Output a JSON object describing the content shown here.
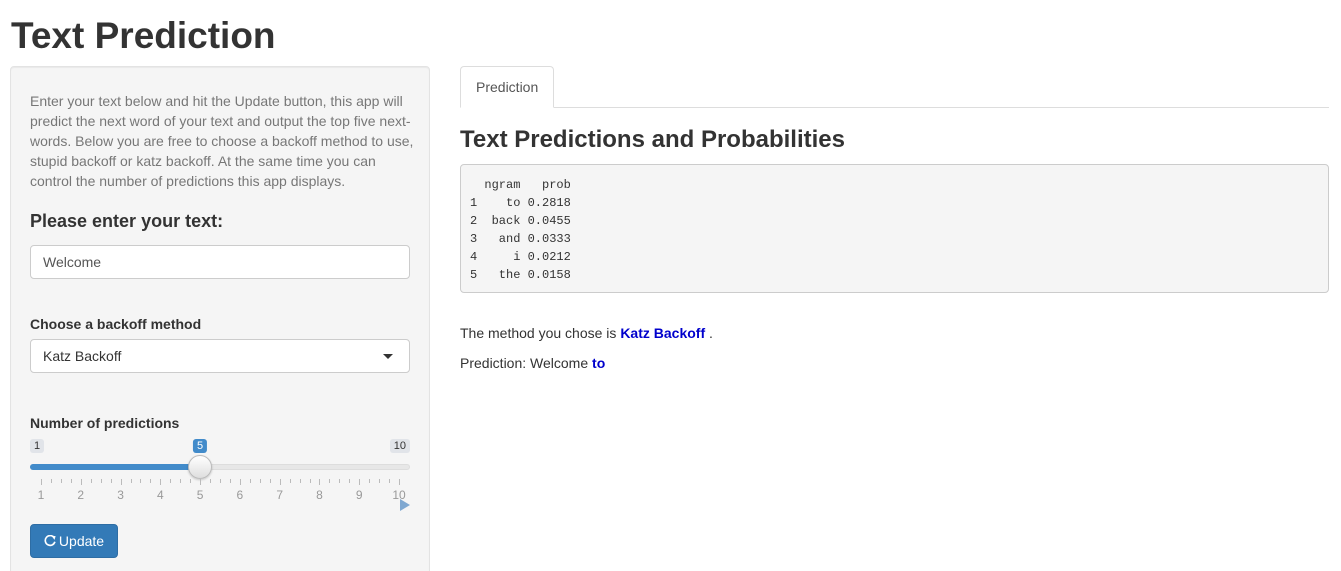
{
  "app": {
    "title": "Text Prediction"
  },
  "sidebar": {
    "intro": "Enter your text below and hit the Update button, this app will predict the next word of your text and output the top five next-words. Below you are free to choose a backoff method to use, stupid backoff or katz backoff. At the same time you can control the number of predictions this app displays.",
    "text_label": "Please enter your text:",
    "text_value": "Welcome",
    "method_label": "Choose a backoff method",
    "method_selected": "Katz Backoff",
    "slider": {
      "label": "Number of predictions",
      "min": 1,
      "max": 10,
      "value": 5,
      "min_label": "1",
      "max_label": "10",
      "value_label": "5",
      "tick_labels": [
        "1",
        "2",
        "3",
        "4",
        "5",
        "6",
        "7",
        "8",
        "9",
        "10"
      ]
    },
    "update_label": "Update",
    "colors": {
      "accent": "#337ab7",
      "slider_fill": "#428bca"
    }
  },
  "main": {
    "tabs": [
      {
        "label": "Prediction",
        "active": true
      }
    ],
    "result_title": "Text Predictions and Probabilities",
    "table": {
      "headers": [
        "ngram",
        "prob"
      ],
      "rows": [
        {
          "index": "1",
          "ngram": "to",
          "prob": "0.2818"
        },
        {
          "index": "2",
          "ngram": "back",
          "prob": "0.0455"
        },
        {
          "index": "3",
          "ngram": "and",
          "prob": "0.0333"
        },
        {
          "index": "4",
          "ngram": "i",
          "prob": "0.0212"
        },
        {
          "index": "5",
          "ngram": "the",
          "prob": "0.0158"
        }
      ]
    },
    "method_prefix": "The method you chose is",
    "method_value": "Katz Backoff",
    "method_suffix": ".",
    "prediction_prefix": "Prediction: Welcome",
    "prediction_word": "to",
    "colors": {
      "highlight": "#0000cc"
    }
  },
  "icons": {
    "dropdown": "chevron-down-icon",
    "update": "refresh-icon",
    "slider_play": "play-icon"
  }
}
